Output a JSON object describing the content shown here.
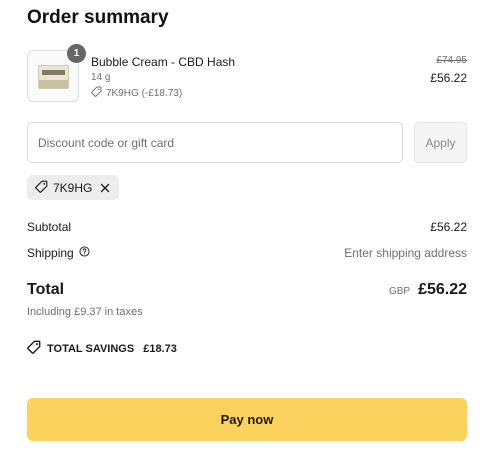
{
  "title": "Order summary",
  "item": {
    "quantity": "1",
    "name": "Bubble Cream - CBD Hash",
    "variant": "14 g",
    "discount": "7K9HG (-£18.73)",
    "original_price": "£74.95",
    "price": "£56.22",
    "thumbnail_icon": "product-pack-image"
  },
  "discount": {
    "placeholder": "Discount code or gift card",
    "value": "",
    "apply_label": "Apply",
    "applied_code": "7K9HG"
  },
  "summary": {
    "subtotal_label": "Subtotal",
    "subtotal_value": "£56.22",
    "shipping_label": "Shipping",
    "shipping_value": "Enter shipping address",
    "total_label": "Total",
    "currency": "GBP",
    "total_value": "£56.22",
    "taxes": "Including £9.37 in taxes",
    "savings_label": "TOTAL SAVINGS",
    "savings_value": "£18.73"
  },
  "pay_label": "Pay now",
  "colors": {
    "pay_button": "#fcd25f",
    "badge": "#666666",
    "muted_text": "#707070"
  }
}
